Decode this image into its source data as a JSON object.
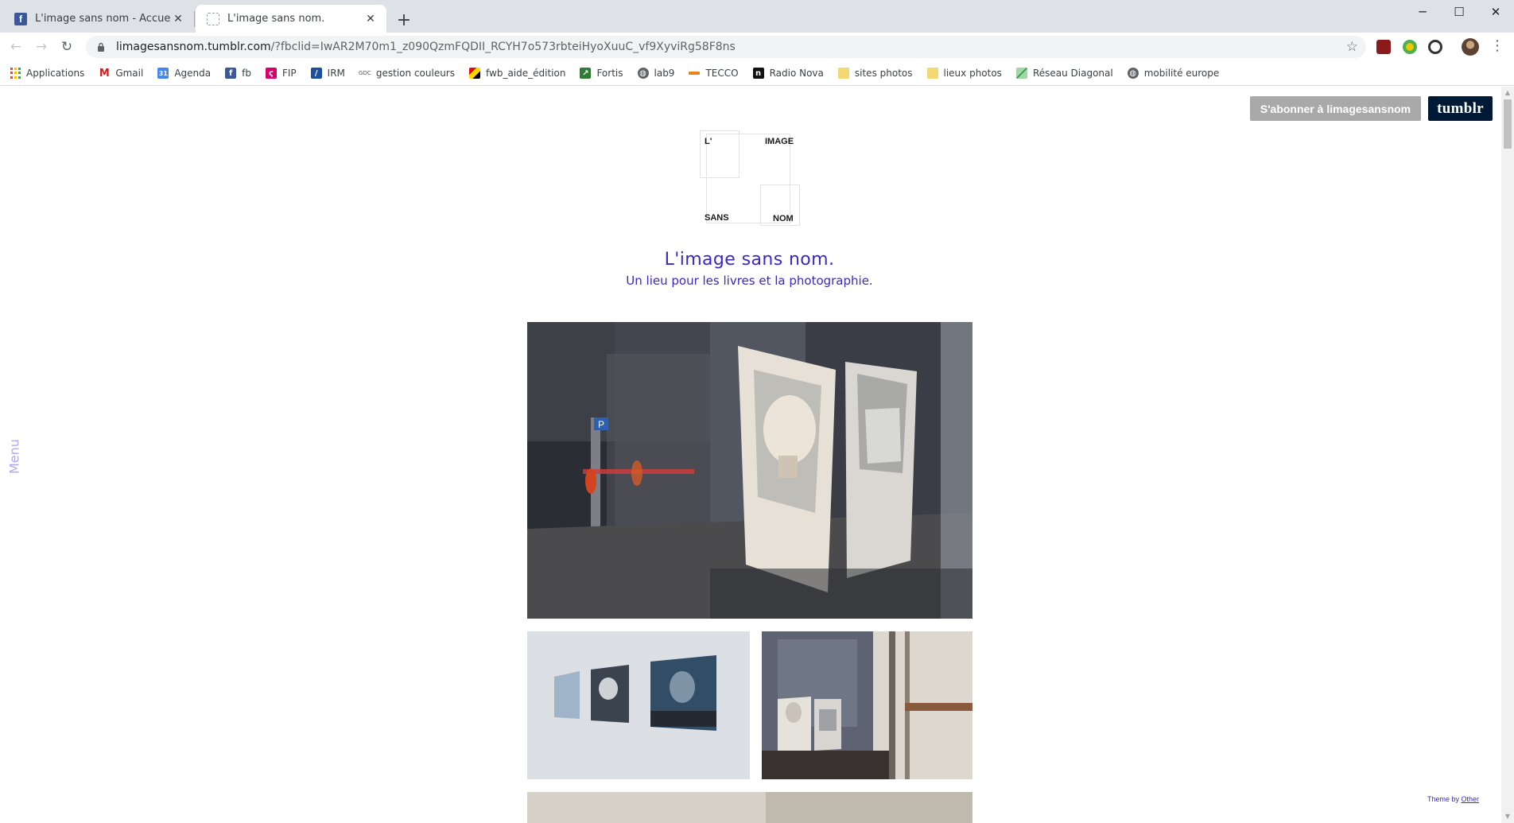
{
  "browser": {
    "tabs": [
      {
        "title": "L'image sans nom - Accueil",
        "favicon": "facebook-icon",
        "active": false
      },
      {
        "title": "L'image sans nom.",
        "favicon": "tumblr-dashed-icon",
        "active": true
      }
    ],
    "url_host": "limagesansnom.tumblr.com",
    "url_path": "/?fbclid=IwAR2M70m1_z090QzmFQDII_RCYH7o573rbteiHyoXuuC_vf9XyviRg58F8ns",
    "bookmarks": [
      {
        "label": "Applications",
        "icon": "apps-grid-icon"
      },
      {
        "label": "Gmail",
        "icon": "gmail-icon"
      },
      {
        "label": "Agenda",
        "icon": "calendar-icon"
      },
      {
        "label": "fb",
        "icon": "facebook-icon"
      },
      {
        "label": "FIP",
        "icon": "fip-icon"
      },
      {
        "label": "IRM",
        "icon": "irm-icon"
      },
      {
        "label": "gestion couleurs",
        "icon": "gdc-icon"
      },
      {
        "label": "fwb_aide_édition",
        "icon": "fwb-icon"
      },
      {
        "label": "Fortis",
        "icon": "fortis-icon"
      },
      {
        "label": "lab9",
        "icon": "globe-icon"
      },
      {
        "label": "TECCO",
        "icon": "tecco-icon"
      },
      {
        "label": "Radio Nova",
        "icon": "radio-nova-icon"
      },
      {
        "label": "sites photos",
        "icon": "folder-icon"
      },
      {
        "label": "lieux photos",
        "icon": "folder-icon"
      },
      {
        "label": "Réseau Diagonal",
        "icon": "diagonal-icon"
      },
      {
        "label": "mobilité europe",
        "icon": "globe-icon"
      }
    ]
  },
  "page": {
    "subscribe_label": "S'abonner à limagesansnom",
    "tumblr_label": "tumblr",
    "logo": {
      "top_left": "L'",
      "top_right": "IMAGE",
      "bottom_left": "SANS",
      "bottom_right": "NOM"
    },
    "title": "L'image sans nom.",
    "subtitle": "Un lieu pour les livres et la photographie.",
    "menu_label": "Menu",
    "photo_1_sign": "P",
    "theme_by": "Theme by",
    "theme_link": "Other",
    "colors": {
      "link": "#3b27c2",
      "menu": "#b4a6f2",
      "tumblr_bg": "#001935",
      "subscribe_bg": "#a9a9a9"
    }
  }
}
